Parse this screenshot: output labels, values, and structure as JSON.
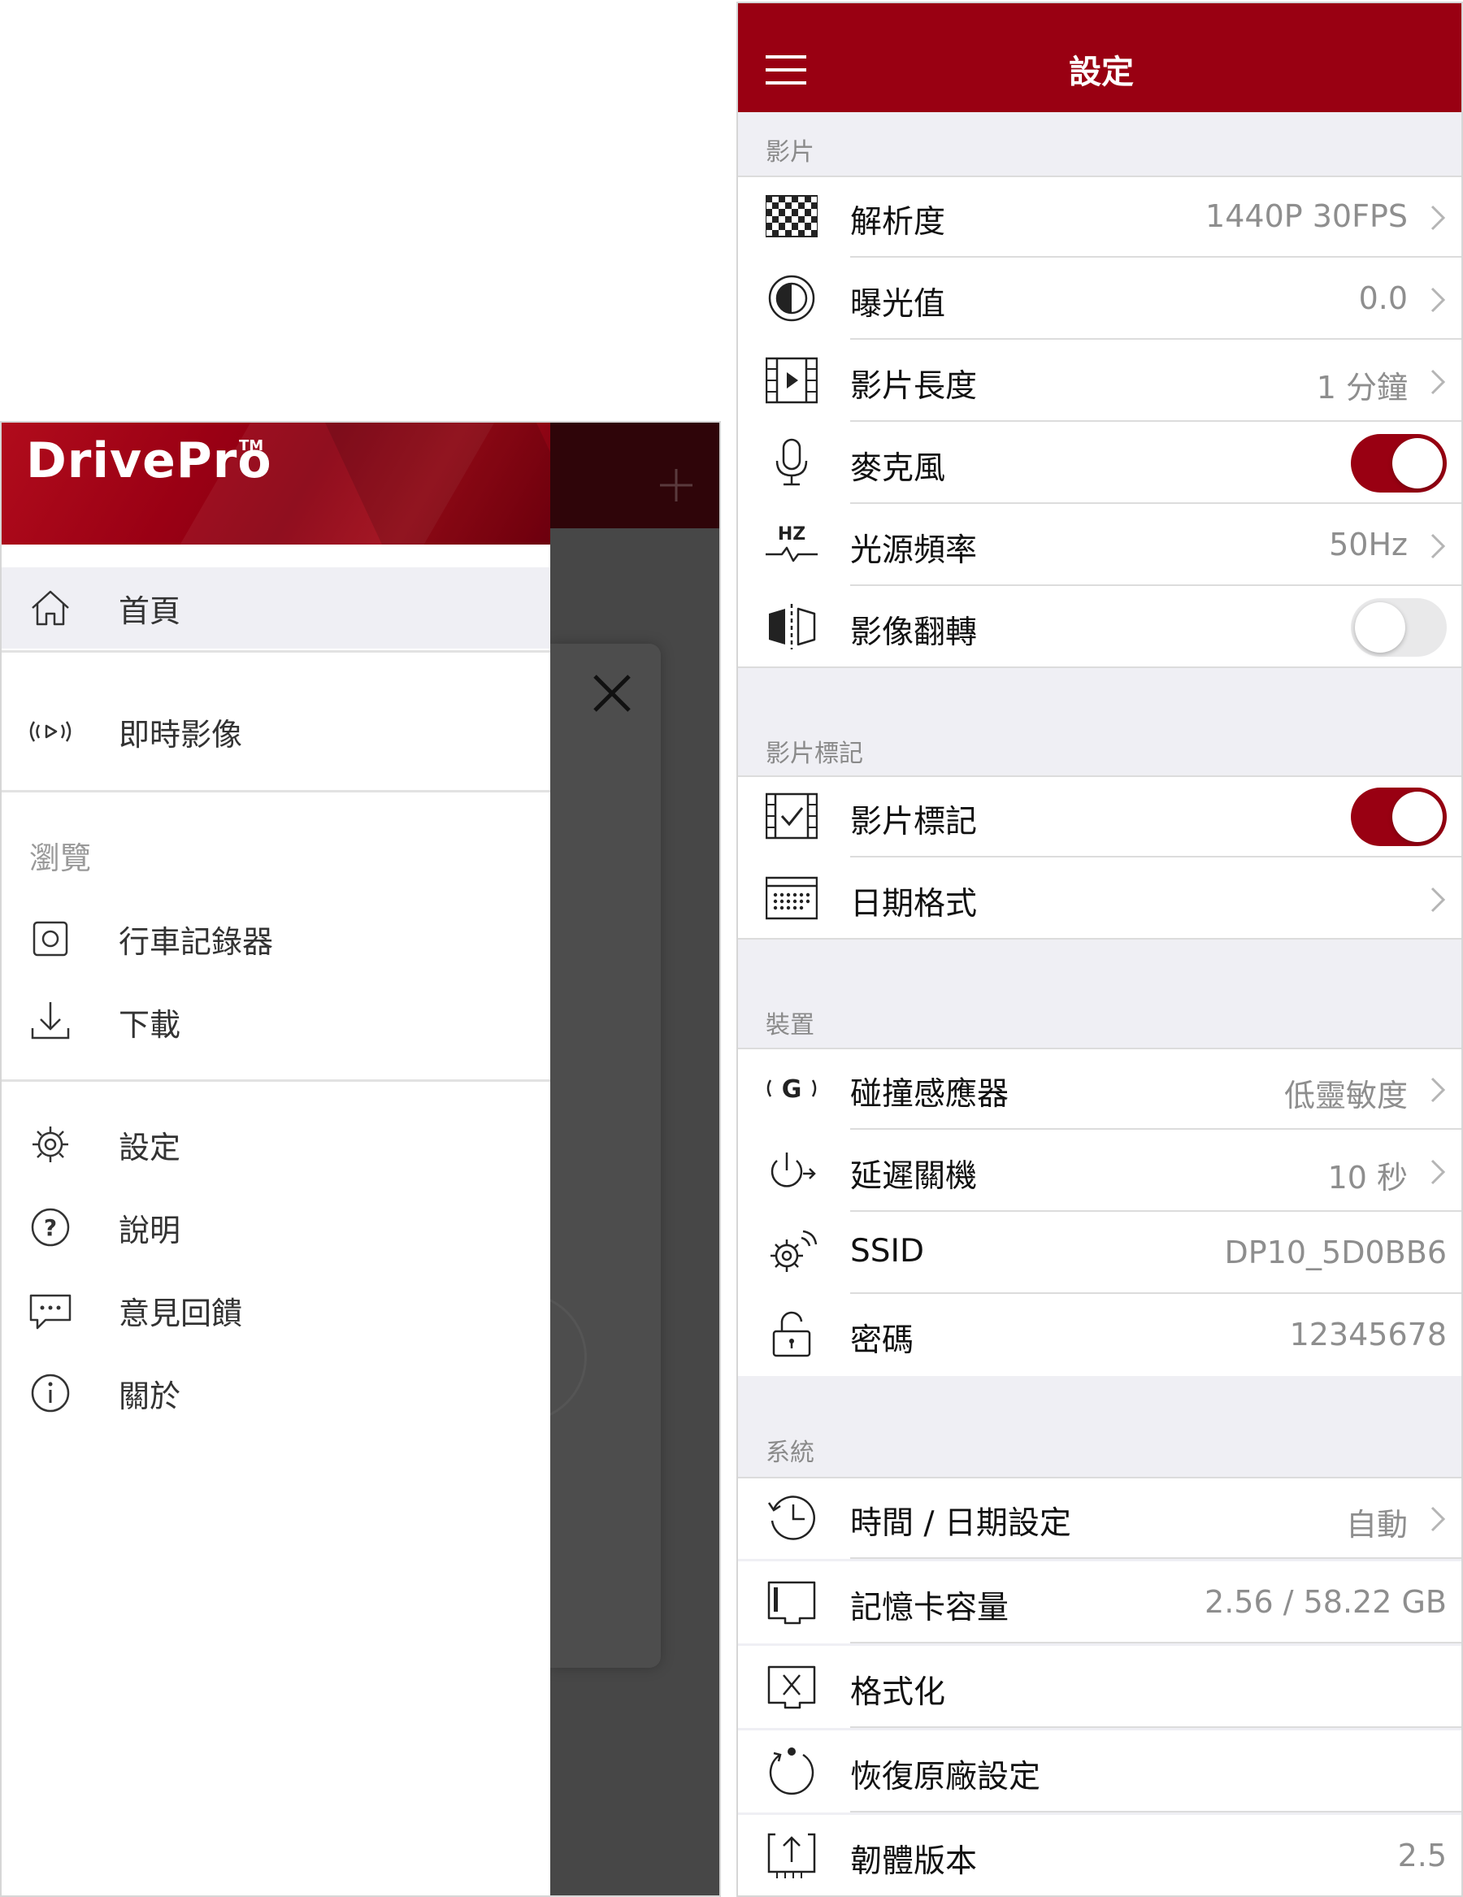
{
  "drawer": {
    "logo": "DrivePro",
    "logo_tm": "TM",
    "items_top": [
      {
        "label": "首頁",
        "icon": "home-icon"
      },
      {
        "label": "即時影像",
        "icon": "live-view-icon"
      }
    ],
    "browse_section": "瀏覽",
    "items_browse": [
      {
        "label": "行車記錄器",
        "icon": "dashcam-icon"
      },
      {
        "label": "下載",
        "icon": "download-icon"
      }
    ],
    "items_bottom": [
      {
        "label": "設定",
        "icon": "gear-icon"
      },
      {
        "label": "說明",
        "icon": "help-icon"
      },
      {
        "label": "意見回饋",
        "icon": "feedback-icon"
      },
      {
        "label": "關於",
        "icon": "info-icon"
      }
    ]
  },
  "settings": {
    "title": "設定",
    "sections": {
      "video": "影片",
      "video_tag": "影片標記",
      "device": "裝置",
      "system": "系統"
    },
    "video_rows": [
      {
        "label": "解析度",
        "value": "1440P 30FPS"
      },
      {
        "label": "曝光值",
        "value": "0.0"
      },
      {
        "label": "影片長度",
        "value": "1 分鐘"
      },
      {
        "label": "麥克風",
        "toggle": "on"
      },
      {
        "label": "光源頻率",
        "value": "50Hz"
      },
      {
        "label": "影像翻轉",
        "toggle": "off"
      }
    ],
    "video_tag_rows": [
      {
        "label": "影片標記",
        "toggle": "on"
      },
      {
        "label": "日期格式",
        "value": ""
      }
    ],
    "device_rows": [
      {
        "label": "碰撞感應器",
        "value": "低靈敏度"
      },
      {
        "label": "延遲關機",
        "value": "10 秒"
      },
      {
        "label": "SSID",
        "value": "DP10_5D0BB6"
      },
      {
        "label": "密碼",
        "value": "12345678"
      }
    ],
    "system_rows": [
      {
        "label": "時間 / 日期設定",
        "value": "自動"
      },
      {
        "label": "記憶卡容量",
        "value": "2.56 / 58.22 GB"
      },
      {
        "label": "格式化",
        "value": ""
      },
      {
        "label": "恢復原廠設定",
        "value": ""
      },
      {
        "label": "韌體版本",
        "value": "2.5"
      }
    ],
    "hz_icon_text": "HZ",
    "gsensor_icon_text": "(G)"
  },
  "colors": {
    "brand_red": "#990012",
    "toggle_off": "#e9e9ea"
  }
}
